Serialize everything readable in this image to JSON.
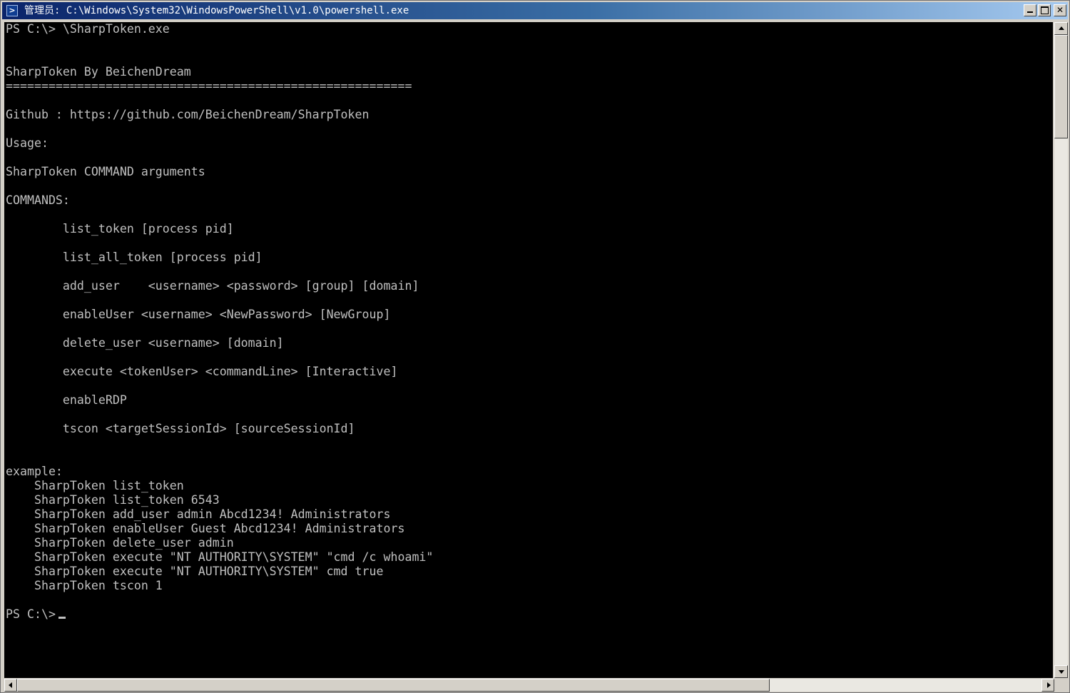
{
  "window": {
    "title": "管理员: C:\\Windows\\System32\\WindowsPowerShell\\v1.0\\powershell.exe",
    "icon": "powershell-icon"
  },
  "console": {
    "text_color": "#c0c0c0",
    "background": "#000000",
    "lines": [
      "PS C:\\> \\SharpToken.exe",
      "",
      "",
      "SharpToken By BeichenDream",
      "=========================================================",
      "",
      "Github : https://github.com/BeichenDream/SharpToken",
      "",
      "Usage:",
      "",
      "SharpToken COMMAND arguments",
      "",
      "COMMANDS:",
      "",
      "        list_token [process pid]",
      "",
      "        list_all_token [process pid]",
      "",
      "        add_user    <username> <password> [group] [domain]",
      "",
      "        enableUser <username> <NewPassword> [NewGroup]",
      "",
      "        delete_user <username> [domain]",
      "",
      "        execute <tokenUser> <commandLine> [Interactive]",
      "",
      "        enableRDP",
      "",
      "        tscon <targetSessionId> [sourceSessionId]",
      "",
      "",
      "example:",
      "    SharpToken list_token",
      "    SharpToken list_token 6543",
      "    SharpToken add_user admin Abcd1234! Administrators",
      "    SharpToken enableUser Guest Abcd1234! Administrators",
      "    SharpToken delete_user admin",
      "    SharpToken execute \"NT AUTHORITY\\SYSTEM\" \"cmd /c whoami\"",
      "    SharpToken execute \"NT AUTHORITY\\SYSTEM\" cmd true",
      "    SharpToken tscon 1",
      ""
    ],
    "prompt": "PS C:\\>"
  }
}
